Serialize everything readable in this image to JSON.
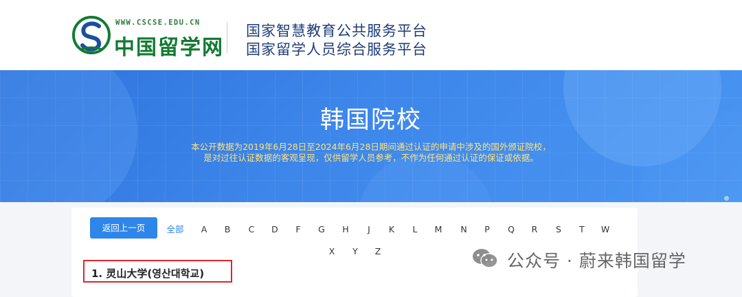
{
  "header": {
    "logo_url_text": "WWW.CSCSE.EDU.CN",
    "logo_name": "中国留学网",
    "platform_line1": "国家智慧教育公共服务平台",
    "platform_line2": "国家留学人员综合服务平台",
    "logo_color": "#137a33",
    "platform_color": "#1d3d78"
  },
  "banner": {
    "title": "韩国院校",
    "desc_line1": "本公开数据为2019年6月28日至2024年6月28日期间通过认证的申请中涉及的国外颁证院校，",
    "desc_line2": "是对过往认证数据的客观呈现，仅供留学人员参考，不作为任何通过认证的保证或依据。",
    "desc_color": "#ffe37a"
  },
  "filter": {
    "back_label": "返回上一页",
    "all_label": "全部",
    "letters_row1": [
      "A",
      "B",
      "C",
      "D",
      "F",
      "G",
      "H",
      "J",
      "K",
      "L",
      "M",
      "N",
      "P",
      "Q",
      "R",
      "S",
      "T",
      "W"
    ],
    "letters_row2": [
      "X",
      "Y",
      "Z"
    ],
    "accent_color": "#2f86ea"
  },
  "results": {
    "items": [
      {
        "index": "1.",
        "name": "灵山大学(영산대학교)"
      }
    ],
    "highlight_color": "#e0242b"
  },
  "watermark": {
    "text": "公众号 · 蔚来韩国留学",
    "icon": "wechat-icon"
  }
}
